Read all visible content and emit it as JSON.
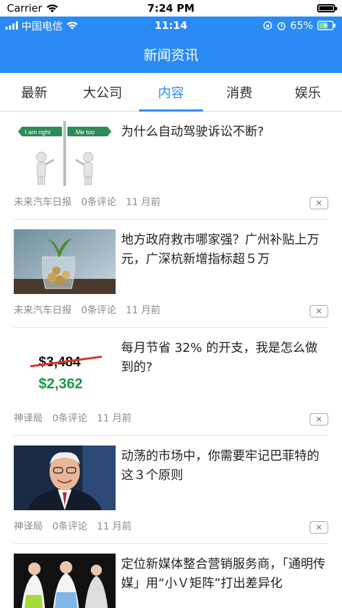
{
  "system_status": {
    "carrier": "Carrier",
    "time": "7:24 PM"
  },
  "app_status": {
    "carrier": "中国电信",
    "time": "11:14",
    "battery": "65%"
  },
  "header": {
    "title": "新闻资讯"
  },
  "tabs": [
    {
      "label": "最新"
    },
    {
      "label": "大公司"
    },
    {
      "label": "内容"
    },
    {
      "label": "消费"
    },
    {
      "label": "娱乐"
    }
  ],
  "active_tab": "内容",
  "articles": [
    {
      "title": "为什么自动驾驶诉讼不断?",
      "source": "未来汽车日报",
      "comments": "0条评论",
      "time": "11 月前",
      "thumb": {
        "sign_left": "I am right",
        "sign_right": "Me too"
      }
    },
    {
      "title": "地方政府救市哪家强？广州补贴上万元，广深杭新增指标超５万",
      "source": "未来汽车日报",
      "comments": "0条评论",
      "time": "11 月前"
    },
    {
      "title": "每月节省 32% 的开支，我是怎么做到的?",
      "source": "神译局",
      "comments": "0条评论",
      "time": "11 月前",
      "thumb": {
        "old_price": "$3,484",
        "new_price": "$2,362"
      }
    },
    {
      "title": "动荡的市场中，你需要牢记巴菲特的这３个原则",
      "source": "神译局",
      "comments": "0条评论",
      "time": "11 月前"
    },
    {
      "title": "定位新媒体整合营销服务商，「通明传媒」用“小Ｖ矩阵”打出差异化"
    }
  ],
  "colors": {
    "accent": "#2a8af6",
    "meta": "#8a8a8a",
    "price_old": "#111111",
    "price_new": "#1a9a4a"
  }
}
